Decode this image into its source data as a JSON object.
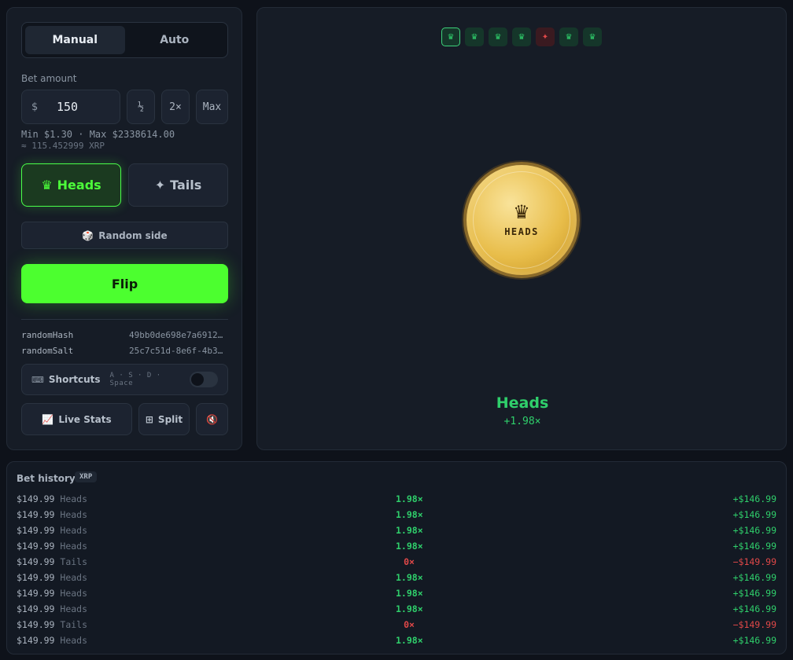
{
  "mode_tabs": [
    {
      "label": "Manual",
      "active": true
    },
    {
      "label": "Auto",
      "active": false
    }
  ],
  "bet": {
    "label": "Bet amount",
    "currency_symbol": "$",
    "value": "150",
    "half_label": "½",
    "double_label": "2×",
    "max_label": "Max",
    "limits": "Min $1.30 · Max $2338614.00",
    "conversion": "≈ 115.452999 XRP"
  },
  "sides": {
    "heads": {
      "icon": "♛",
      "label": "Heads",
      "selected": true
    },
    "tails": {
      "icon": "✦",
      "label": "Tails",
      "selected": false
    }
  },
  "random_side": {
    "icon": "🎲",
    "label": "Random side"
  },
  "flip_label": "Flip",
  "fairness": {
    "hash_key": "randomHash",
    "hash_value": "49bb0de698e7a6912…",
    "salt_key": "randomSalt",
    "salt_value": "25c7c51d-8e6f-4b3…"
  },
  "shortcuts": {
    "icon": "⌨",
    "label": "Shortcuts",
    "keys": "A · S · D · Space",
    "enabled": false
  },
  "bottom_buttons": {
    "live_stats": {
      "icon": "📈",
      "label": "Live Stats"
    },
    "split": {
      "icon": "⊞",
      "label": "Split"
    },
    "sound": {
      "icon": "🔇"
    }
  },
  "recent_results": [
    "heads",
    "heads",
    "heads",
    "heads",
    "tails",
    "heads",
    "heads"
  ],
  "coin": {
    "icon": "♛",
    "face": "HEADS"
  },
  "result": {
    "side": "Heads",
    "multiplier": "+1.98×"
  },
  "history": {
    "title": "Bet history",
    "currency_badge": "XRP",
    "rows": [
      {
        "amount": "$149.99",
        "side": "Heads",
        "multiplier": "1.98×",
        "profit": "+$146.99",
        "win": true
      },
      {
        "amount": "$149.99",
        "side": "Heads",
        "multiplier": "1.98×",
        "profit": "+$146.99",
        "win": true
      },
      {
        "amount": "$149.99",
        "side": "Heads",
        "multiplier": "1.98×",
        "profit": "+$146.99",
        "win": true
      },
      {
        "amount": "$149.99",
        "side": "Heads",
        "multiplier": "1.98×",
        "profit": "+$146.99",
        "win": true
      },
      {
        "amount": "$149.99",
        "side": "Tails",
        "multiplier": "0×",
        "profit": "−$149.99",
        "win": false
      },
      {
        "amount": "$149.99",
        "side": "Heads",
        "multiplier": "1.98×",
        "profit": "+$146.99",
        "win": true
      },
      {
        "amount": "$149.99",
        "side": "Heads",
        "multiplier": "1.98×",
        "profit": "+$146.99",
        "win": true
      },
      {
        "amount": "$149.99",
        "side": "Heads",
        "multiplier": "1.98×",
        "profit": "+$146.99",
        "win": true
      },
      {
        "amount": "$149.99",
        "side": "Tails",
        "multiplier": "0×",
        "profit": "−$149.99",
        "win": false
      },
      {
        "amount": "$149.99",
        "side": "Heads",
        "multiplier": "1.98×",
        "profit": "+$146.99",
        "win": true
      }
    ]
  }
}
